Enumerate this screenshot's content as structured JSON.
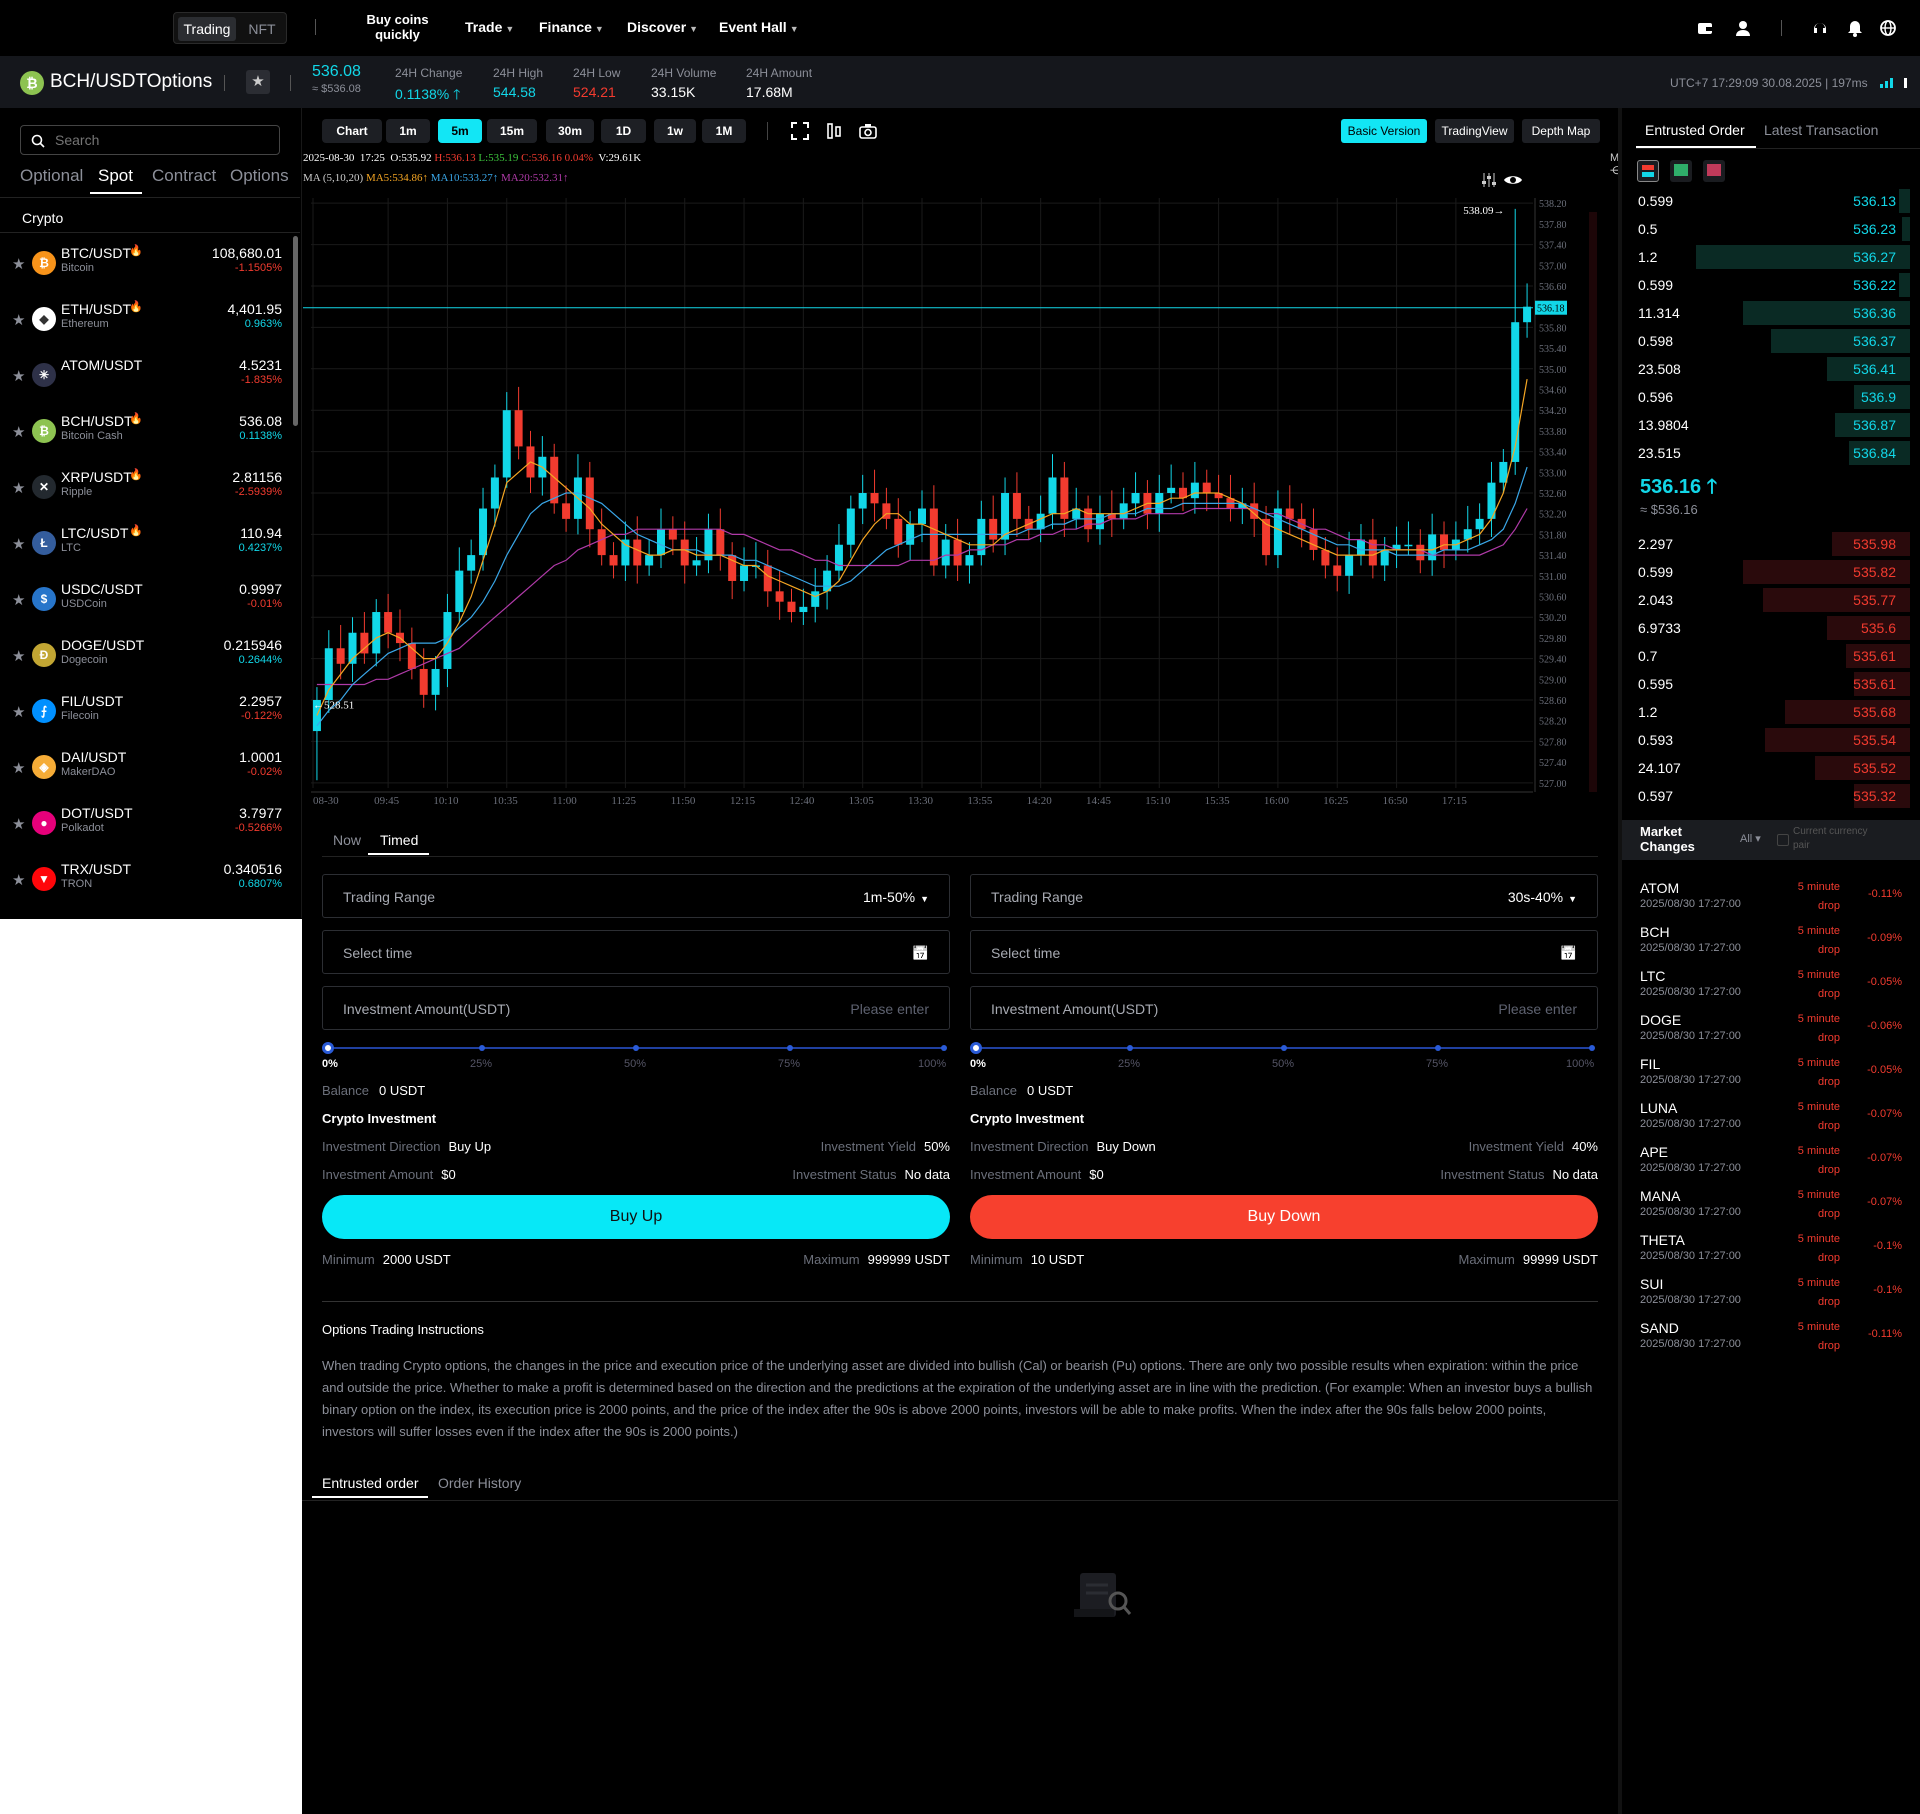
{
  "nav": {
    "mode_tabs": [
      "Trading",
      "NFT"
    ],
    "buy_coins": [
      "Buy coins",
      "quickly"
    ],
    "items": [
      "Trade",
      "Finance",
      "Discover",
      "Event Hall"
    ]
  },
  "header": {
    "pair": "BCH/USDTOptions",
    "price": "536.08",
    "price_usd": "≈ $536.08",
    "stats": [
      {
        "label": "24H Change",
        "value": "0.1138%"
      },
      {
        "label": "24H High",
        "value": "544.58"
      },
      {
        "label": "24H Low",
        "value": "524.21"
      },
      {
        "label": "24H Volume",
        "value": "33.15K"
      },
      {
        "label": "24H Amount",
        "value": "17.68M"
      }
    ],
    "time": "UTC+7 17:29:09 30.08.2025 | 197ms"
  },
  "left": {
    "search_placeholder": "Search",
    "tabs": [
      "Optional",
      "Spot",
      "Contract",
      "Options"
    ],
    "section": "Crypto",
    "coins": [
      {
        "pair": "BTC/USDT",
        "name": "Bitcoin",
        "price": "108,680.01",
        "change": "-1.1505%",
        "hot": true,
        "color": "#f7931a",
        "glyph": "₿"
      },
      {
        "pair": "ETH/USDT",
        "name": "Ethereum",
        "price": "4,401.95",
        "change": "0.963%",
        "hot": true,
        "color": "#ffffff",
        "glyph": "◆"
      },
      {
        "pair": "ATOM/USDT",
        "name": "",
        "price": "4.5231",
        "change": "-1.835%",
        "hot": false,
        "color": "#2e3148",
        "glyph": "✳"
      },
      {
        "pair": "BCH/USDT",
        "name": "Bitcoin Cash",
        "price": "536.08",
        "change": "0.1138%",
        "hot": true,
        "color": "#8dc351",
        "glyph": "₿"
      },
      {
        "pair": "XRP/USDT",
        "name": "Ripple",
        "price": "2.81156",
        "change": "-2.5939%",
        "hot": true,
        "color": "#23292f",
        "glyph": "✕"
      },
      {
        "pair": "LTC/USDT",
        "name": "LTC",
        "price": "110.94",
        "change": "0.4237%",
        "hot": true,
        "color": "#345d9d",
        "glyph": "Ł"
      },
      {
        "pair": "USDC/USDT",
        "name": "USDCoin",
        "price": "0.9997",
        "change": "-0.01%",
        "hot": false,
        "color": "#2775ca",
        "glyph": "$"
      },
      {
        "pair": "DOGE/USDT",
        "name": "Dogecoin",
        "price": "0.215946",
        "change": "0.2644%",
        "hot": false,
        "color": "#c2a633",
        "glyph": "Ð"
      },
      {
        "pair": "FIL/USDT",
        "name": "Filecoin",
        "price": "2.2957",
        "change": "-0.122%",
        "hot": false,
        "color": "#0090ff",
        "glyph": "⨍"
      },
      {
        "pair": "DAI/USDT",
        "name": "MakerDAO",
        "price": "1.0001",
        "change": "-0.02%",
        "hot": false,
        "color": "#f5ac37",
        "glyph": "◈"
      },
      {
        "pair": "DOT/USDT",
        "name": "Polkadot",
        "price": "3.7977",
        "change": "-0.5266%",
        "hot": false,
        "color": "#e6007a",
        "glyph": "●"
      },
      {
        "pair": "TRX/USDT",
        "name": "TRON",
        "price": "0.340516",
        "change": "0.6807%",
        "hot": false,
        "color": "#ff060a",
        "glyph": "▼"
      }
    ]
  },
  "chart_toolbar": {
    "timeframes": [
      "Chart",
      "1m",
      "5m",
      "15m",
      "30m",
      "1D",
      "1w",
      "1M"
    ],
    "active": "5m",
    "views": [
      "Basic Version",
      "TradingView",
      "Depth Map"
    ]
  },
  "chart_data": {
    "type": "candlestick",
    "info_line": {
      "date": "2025-08-30",
      "time": "17:25",
      "O": "O:535.92",
      "H": "H:536.13",
      "L": "L:535.19",
      "C": "C:536.16",
      "chg": "0.04%",
      "V": "V:29.61K"
    },
    "ma_line": {
      "label": "MA (5,10,20)",
      "ma5": "MA5:534.86↑",
      "ma10": "MA10:533.27↑",
      "ma20": "MA20:532.31↑"
    },
    "y_ticks": [
      "538.20",
      "537.80",
      "537.40",
      "537.00",
      "536.60",
      "536.18",
      "535.80",
      "535.40",
      "535.00",
      "534.60",
      "534.20",
      "533.80",
      "533.40",
      "533.00",
      "532.60",
      "532.20",
      "531.80",
      "531.40",
      "531.00",
      "530.60",
      "530.20",
      "529.80",
      "529.40",
      "529.00",
      "528.60",
      "528.20",
      "527.80",
      "527.40",
      "527.00"
    ],
    "ylim": [
      526.9,
      538.3
    ],
    "x_ticks": [
      "08-30",
      "09:45",
      "10:10",
      "10:35",
      "11:00",
      "11:25",
      "11:50",
      "12:15",
      "12:40",
      "13:05",
      "13:30",
      "13:55",
      "14:20",
      "14:45",
      "15:10",
      "15:35",
      "16:00",
      "16:25",
      "16:50",
      "17:15"
    ],
    "current_price": "536.18",
    "max_label": "538.09→",
    "min_label": "←528.51",
    "closes": [
      528.6,
      529.6,
      529.3,
      529.9,
      529.5,
      530.3,
      529.9,
      529.7,
      529.2,
      528.7,
      529.2,
      530.3,
      531.1,
      531.4,
      532.3,
      532.9,
      534.2,
      533.5,
      532.9,
      533.3,
      532.4,
      532.1,
      532.9,
      531.9,
      531.4,
      531.2,
      531.7,
      531.2,
      531.4,
      531.9,
      531.7,
      531.2,
      531.3,
      531.9,
      531.4,
      530.9,
      531.2,
      531.2,
      530.7,
      530.5,
      530.3,
      530.4,
      530.7,
      531.1,
      531.6,
      532.3,
      532.6,
      532.4,
      532.1,
      531.6,
      532.0,
      532.3,
      531.2,
      531.7,
      531.2,
      531.4,
      532.1,
      531.7,
      532.6,
      532.1,
      531.9,
      532.2,
      532.9,
      532.1,
      532.3,
      531.9,
      532.2,
      532.1,
      532.4,
      532.6,
      532.2,
      532.6,
      532.7,
      532.5,
      532.8,
      532.6,
      532.5,
      532.3,
      532.4,
      532.1,
      531.4,
      532.3,
      532.1,
      531.9,
      531.5,
      531.2,
      531.0,
      531.4,
      531.7,
      531.2,
      531.5,
      531.6,
      531.6,
      531.3,
      531.8,
      531.5,
      531.7,
      531.9,
      532.1,
      532.8,
      533.2,
      535.9,
      536.2
    ],
    "ma5": [
      528.3,
      528.8,
      529.1,
      529.4,
      529.6,
      529.8,
      529.9,
      529.8,
      529.6,
      529.4,
      529.4,
      529.7,
      530.1,
      530.6,
      531.3,
      532.0,
      532.8,
      533.0,
      533.2,
      533.1,
      532.9,
      532.7,
      532.5,
      532.3,
      532.0,
      531.8,
      531.6,
      531.5,
      531.4,
      531.4,
      531.5,
      531.5,
      531.4,
      531.4,
      531.4,
      531.3,
      531.2,
      531.2,
      531.0,
      530.9,
      530.8,
      530.7,
      530.6,
      530.7,
      530.9,
      531.3,
      531.7,
      532.0,
      532.2,
      532.2,
      532.0,
      532.0,
      531.9,
      531.8,
      531.7,
      531.6,
      531.6,
      531.6,
      531.8,
      531.9,
      532.0,
      532.1,
      532.2,
      532.2,
      532.3,
      532.2,
      532.2,
      532.2,
      532.2,
      532.3,
      532.4,
      532.4,
      532.5,
      532.5,
      532.6,
      532.6,
      532.6,
      532.5,
      532.4,
      532.2,
      532.0,
      531.9,
      531.8,
      531.7,
      531.6,
      531.5,
      531.4,
      531.4,
      531.4,
      531.4,
      531.5,
      531.5,
      531.5,
      531.5,
      531.5,
      531.6,
      531.6,
      531.7,
      531.8,
      532.1,
      532.6,
      533.5,
      534.8
    ],
    "ma10": [
      528.1,
      528.4,
      528.6,
      528.9,
      529.1,
      529.3,
      529.5,
      529.6,
      529.7,
      529.7,
      529.7,
      529.8,
      530.0,
      530.2,
      530.5,
      530.9,
      531.4,
      531.8,
      532.2,
      532.4,
      532.5,
      532.6,
      532.6,
      532.5,
      532.4,
      532.2,
      532.0,
      531.8,
      531.7,
      531.6,
      531.5,
      531.5,
      531.5,
      531.4,
      531.4,
      531.4,
      531.3,
      531.3,
      531.2,
      531.1,
      531.0,
      530.9,
      530.8,
      530.8,
      530.8,
      530.9,
      531.1,
      531.3,
      531.5,
      531.6,
      531.7,
      531.8,
      531.8,
      531.8,
      531.8,
      531.8,
      531.8,
      531.8,
      531.8,
      531.8,
      531.9,
      531.9,
      532.0,
      532.0,
      532.1,
      532.1,
      532.1,
      532.2,
      532.2,
      532.2,
      532.3,
      532.3,
      532.3,
      532.4,
      532.4,
      532.4,
      532.4,
      532.4,
      532.4,
      532.3,
      532.2,
      532.1,
      532.0,
      531.9,
      531.8,
      531.7,
      531.6,
      531.6,
      531.5,
      531.5,
      531.5,
      531.4,
      531.4,
      531.4,
      531.4,
      531.5,
      531.5,
      531.5,
      531.6,
      531.7,
      531.9,
      532.4,
      533.1
    ],
    "ma20": [
      528.9,
      528.9,
      528.9,
      528.9,
      528.9,
      529.0,
      529.0,
      529.1,
      529.2,
      529.3,
      529.4,
      529.5,
      529.6,
      529.8,
      530.0,
      530.2,
      530.4,
      530.6,
      530.8,
      531.0,
      531.2,
      531.3,
      531.5,
      531.6,
      531.7,
      531.8,
      531.8,
      531.9,
      531.9,
      531.9,
      531.9,
      531.9,
      531.9,
      531.9,
      531.9,
      531.8,
      531.8,
      531.7,
      531.6,
      531.5,
      531.5,
      531.4,
      531.3,
      531.3,
      531.2,
      531.2,
      531.2,
      531.2,
      531.2,
      531.2,
      531.3,
      531.3,
      531.3,
      531.4,
      531.4,
      531.5,
      531.5,
      531.6,
      531.6,
      531.7,
      531.7,
      531.8,
      531.8,
      531.9,
      531.9,
      532.0,
      532.0,
      532.1,
      532.1,
      532.1,
      532.2,
      532.2,
      532.2,
      532.2,
      532.3,
      532.3,
      532.3,
      532.3,
      532.3,
      532.3,
      532.2,
      532.2,
      532.1,
      532.0,
      531.9,
      531.9,
      531.8,
      531.7,
      531.7,
      531.6,
      531.6,
      531.5,
      531.5,
      531.5,
      531.4,
      531.4,
      531.4,
      531.4,
      531.4,
      531.5,
      531.6,
      531.9,
      532.3
    ]
  },
  "trade": {
    "tabs": [
      "Now",
      "Timed"
    ],
    "active_tab": "Timed",
    "panels": [
      {
        "trading_range_label": "Trading Range",
        "trading_range": "1m-50%",
        "select_time": "Select time",
        "amount_label": "Investment Amount(USDT)",
        "amount_placeholder": "Please enter",
        "pcts": [
          "0%",
          "25%",
          "50%",
          "75%",
          "100%"
        ],
        "balance_label": "Balance",
        "balance": "0 USDT",
        "title": "Crypto Investment",
        "dir_label": "Investment Direction",
        "dir": "Buy Up",
        "yield_label": "Investment Yield",
        "yield": "50%",
        "amt_label": "Investment Amount",
        "amt": "$0",
        "status_label": "Investment Status",
        "status": "No data",
        "button": "Buy Up",
        "min_label": "Minimum",
        "min": "2000 USDT",
        "max_label": "Maximum",
        "max": "999999 USDT"
      },
      {
        "trading_range_label": "Trading Range",
        "trading_range": "30s-40%",
        "select_time": "Select time",
        "amount_label": "Investment Amount(USDT)",
        "amount_placeholder": "Please enter",
        "pcts": [
          "0%",
          "25%",
          "50%",
          "75%",
          "100%"
        ],
        "balance_label": "Balance",
        "balance": "0 USDT",
        "title": "Crypto Investment",
        "dir_label": "Investment Direction",
        "dir": "Buy Down",
        "yield_label": "Investment Yield",
        "yield": "40%",
        "amt_label": "Investment Amount",
        "amt": "$0",
        "status_label": "Investment Status",
        "status": "No data",
        "button": "Buy Down",
        "min_label": "Minimum",
        "min": "10 USDT",
        "max_label": "Maximum",
        "max": "99999 USDT"
      }
    ],
    "instructions_title": "Options Trading Instructions",
    "instructions": "When trading Crypto options, the changes in the price and execution price of the underlying asset are divided into bullish (Cal) or bearish (Pu) options. There are only two possible results when expiration: within the price and outside the price. Whether to make a profit is determined based on the direction and the predictions at the expiration of the underlying asset are in line with the prediction. (For example: When an investor buys a bullish binary option on the index, its execution price is 2000 points, and the price of the index after the 90s is above 2000 points, investors will be able to make profits. When the index after the 90s falls below 2000 points, investors will suffer losses even if the index after the 90s is 2000 points.)",
    "order_tabs": [
      "Entrusted order",
      "Order History"
    ]
  },
  "orderbook": {
    "tabs": [
      "Entrusted Order",
      "Latest Transaction"
    ],
    "asks": [
      {
        "q": "0.599",
        "p": "536.13",
        "d": 0.04
      },
      {
        "q": "0.5",
        "p": "536.23",
        "d": 0.03
      },
      {
        "q": "1.2",
        "p": "536.27",
        "d": 0.77
      },
      {
        "q": "0.599",
        "p": "536.22",
        "d": 0.04
      },
      {
        "q": "11.314",
        "p": "536.36",
        "d": 0.6
      },
      {
        "q": "0.598",
        "p": "536.37",
        "d": 0.5
      },
      {
        "q": "23.508",
        "p": "536.41",
        "d": 0.3
      },
      {
        "q": "0.596",
        "p": "536.9",
        "d": 0.2
      },
      {
        "q": "13.9804",
        "p": "536.87",
        "d": 0.27
      },
      {
        "q": "23.515",
        "p": "536.84",
        "d": 0.22
      }
    ],
    "mid_price": "536.16",
    "mid_usd": "≈ $536.16",
    "bids": [
      {
        "q": "2.297",
        "p": "535.98",
        "d": 0.28
      },
      {
        "q": "0.599",
        "p": "535.82",
        "d": 0.6
      },
      {
        "q": "2.043",
        "p": "535.77",
        "d": 0.53
      },
      {
        "q": "6.9733",
        "p": "535.6",
        "d": 0.3
      },
      {
        "q": "0.7",
        "p": "535.61",
        "d": 0.23
      },
      {
        "q": "0.595",
        "p": "535.61",
        "d": 0.2
      },
      {
        "q": "1.2",
        "p": "535.68",
        "d": 0.45
      },
      {
        "q": "0.593",
        "p": "535.54",
        "d": 0.52
      },
      {
        "q": "24.107",
        "p": "535.52",
        "d": 0.34
      },
      {
        "q": "0.597",
        "p": "535.32",
        "d": 0.2
      }
    ]
  },
  "market_changes": {
    "title": [
      "Market",
      "Changes"
    ],
    "filter": "All",
    "current_pair": [
      "Current currency",
      "pair"
    ],
    "items": [
      {
        "coin": "ATOM",
        "time": "2025/08/30 17:27:00",
        "kind": [
          "5 minute",
          "drop"
        ],
        "pct": "-0.11%"
      },
      {
        "coin": "BCH",
        "time": "2025/08/30 17:27:00",
        "kind": [
          "5 minute",
          "drop"
        ],
        "pct": "-0.09%"
      },
      {
        "coin": "LTC",
        "time": "2025/08/30 17:27:00",
        "kind": [
          "5 minute",
          "drop"
        ],
        "pct": "-0.05%"
      },
      {
        "coin": "DOGE",
        "time": "2025/08/30 17:27:00",
        "kind": [
          "5 minute",
          "drop"
        ],
        "pct": "-0.06%"
      },
      {
        "coin": "FIL",
        "time": "2025/08/30 17:27:00",
        "kind": [
          "5 minute",
          "drop"
        ],
        "pct": "-0.05%"
      },
      {
        "coin": "LUNA",
        "time": "2025/08/30 17:27:00",
        "kind": [
          "5 minute",
          "drop"
        ],
        "pct": "-0.07%"
      },
      {
        "coin": "APE",
        "time": "2025/08/30 17:27:00",
        "kind": [
          "5 minute",
          "drop"
        ],
        "pct": "-0.07%"
      },
      {
        "coin": "MANA",
        "time": "2025/08/30 17:27:00",
        "kind": [
          "5 minute",
          "drop"
        ],
        "pct": "-0.07%"
      },
      {
        "coin": "THETA",
        "time": "2025/08/30 17:27:00",
        "kind": [
          "5 minute",
          "drop"
        ],
        "pct": "-0.1%"
      },
      {
        "coin": "SUI",
        "time": "2025/08/30 17:27:00",
        "kind": [
          "5 minute",
          "drop"
        ],
        "pct": "-0.1%"
      },
      {
        "coin": "SAND",
        "time": "2025/08/30 17:27:00",
        "kind": [
          "5 minute",
          "drop"
        ],
        "pct": "-0.11%"
      }
    ]
  },
  "colors": {
    "up": "#12d7e8",
    "down": "#f23b2f",
    "ma5": "#f5a623",
    "ma10": "#3aa7e8",
    "ma20": "#b03aa8"
  }
}
